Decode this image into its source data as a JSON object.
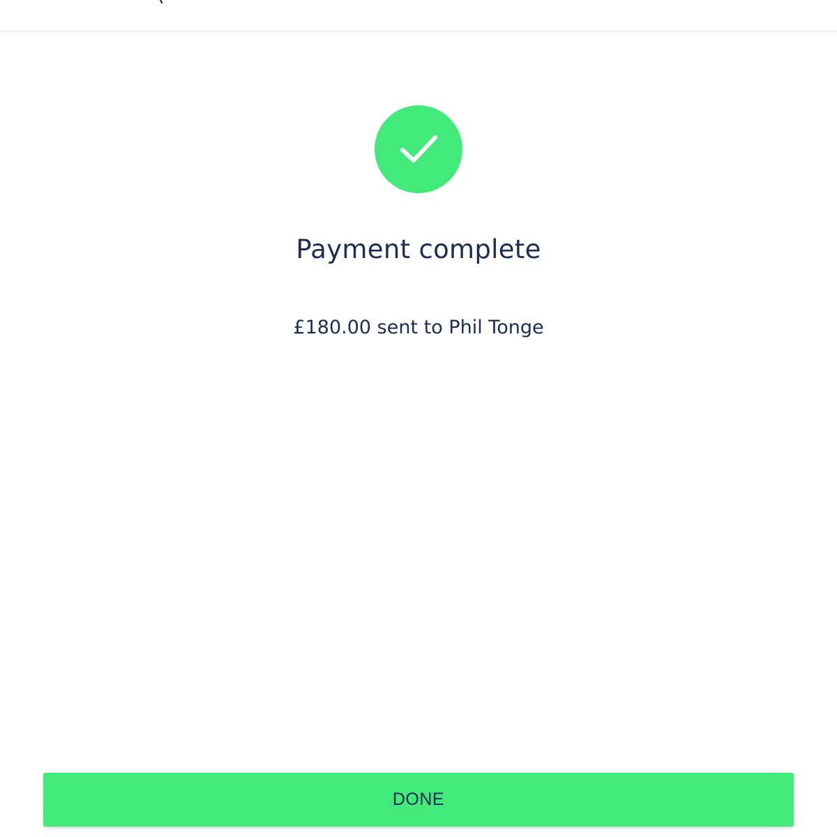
{
  "status": {
    "icon": "checkmark-icon",
    "title": "Payment complete",
    "message": "£180.00 sent to Phil Tonge"
  },
  "actions": {
    "done_label": "DONE"
  },
  "colors": {
    "accent": "#43e97b",
    "text": "#1c2d4f",
    "background": "#ffffff"
  }
}
